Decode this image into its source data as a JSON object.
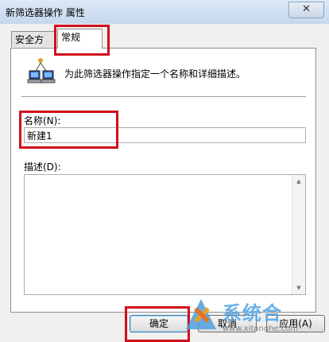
{
  "window": {
    "title": "新筛选器操作 属性",
    "close_symbol": "✕"
  },
  "tabs": [
    {
      "label": "安全方法"
    },
    {
      "label": "常规"
    }
  ],
  "general": {
    "description": "为此筛选器操作指定一个名称和详细描述。",
    "name_label": "名称(N):",
    "name_value": "新建1",
    "desc_label": "描述(D):",
    "desc_value": ""
  },
  "buttons": {
    "ok": "确定",
    "cancel": "取消",
    "apply": "应用(A)"
  },
  "watermark": {
    "text": "系统合",
    "url": "www.xitonghe.com"
  },
  "colors": {
    "highlight": "#d0101c",
    "watermark": "#5aa8e6"
  },
  "icons": {
    "filter_icon": "network-computers-icon",
    "close": "close-icon"
  }
}
